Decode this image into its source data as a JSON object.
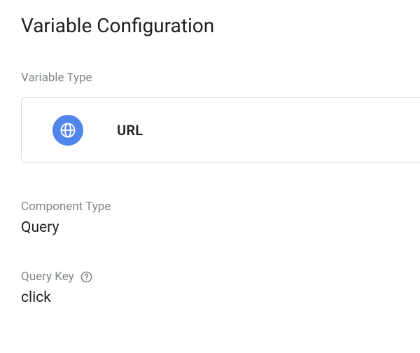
{
  "title": "Variable Configuration",
  "variableType": {
    "label": "Variable Type",
    "icon": "globe-icon",
    "name": "URL"
  },
  "componentType": {
    "label": "Component Type",
    "value": "Query"
  },
  "queryKey": {
    "label": "Query Key",
    "helpIcon": "help-icon",
    "value": "click"
  }
}
